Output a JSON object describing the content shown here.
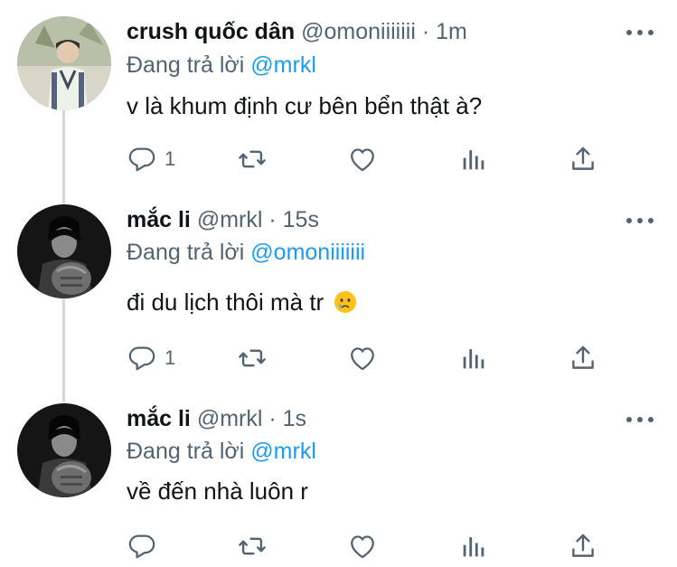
{
  "tweets": [
    {
      "name": "crush quốc dân",
      "handle": "@omoniiiiiii",
      "sep": "·",
      "time": "1m",
      "reply_prefix": "Đang trả lời",
      "reply_to": "@mrkl",
      "text": "v là khum định cư bên bển thật à?",
      "reply_count": "1"
    },
    {
      "name": "mắc li",
      "handle": "@mrkl",
      "sep": "·",
      "time": "15s",
      "reply_prefix": "Đang trả lời",
      "reply_to": "@omoniiiiiii",
      "text": "đi du lịch thôi mà tr",
      "emoji_icon": "crying-face-icon",
      "reply_count": "1"
    },
    {
      "name": "mắc li",
      "handle": "@mrkl",
      "sep": "·",
      "time": "1s",
      "reply_prefix": "Đang trả lời",
      "reply_to": "@mrkl",
      "text": "về đến nhà luôn r",
      "reply_count": ""
    }
  ],
  "icons": [
    "reply-icon",
    "retweet-icon",
    "like-icon",
    "analytics-icon",
    "share-icon",
    "more-icon"
  ],
  "colors": {
    "text": "#0f1419",
    "secondary": "#536471",
    "link": "#1d9bf0",
    "thread": "#cfd9de"
  }
}
